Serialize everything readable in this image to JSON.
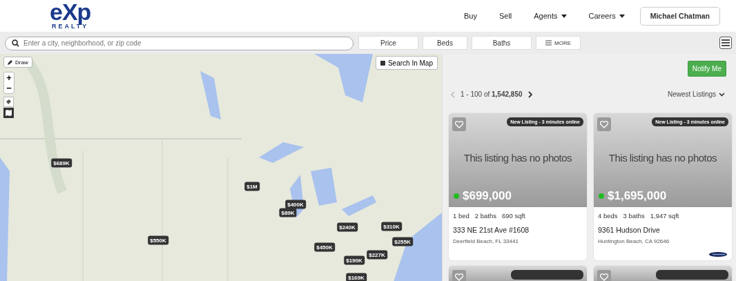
{
  "logo": {
    "mark": "eXp",
    "sub": "REALTY"
  },
  "nav": [
    {
      "label": "Buy",
      "dropdown": false
    },
    {
      "label": "Sell",
      "dropdown": false
    },
    {
      "label": "Agents",
      "dropdown": true
    },
    {
      "label": "Careers",
      "dropdown": true
    }
  ],
  "user_button": "Michael Chatman",
  "search": {
    "placeholder": "Enter a city, neighborhood, or zip code"
  },
  "filters": [
    {
      "label": "Price",
      "kind": "plain"
    },
    {
      "label": "Beds",
      "kind": "plain"
    },
    {
      "label": "Baths",
      "kind": "plain"
    },
    {
      "label": "MORE",
      "kind": "more"
    }
  ],
  "map": {
    "draw_button": "Draw",
    "zoom_in": "+",
    "zoom_out": "−",
    "search_in_map": "Search In Map",
    "pins": [
      {
        "label": "$689K"
      },
      {
        "label": "$1M"
      },
      {
        "label": "$400K"
      },
      {
        "label": "$89K"
      },
      {
        "label": "$240K"
      },
      {
        "label": "$550K"
      },
      {
        "label": "$450K"
      },
      {
        "label": "$310K"
      },
      {
        "label": "$255K"
      },
      {
        "label": "$227K"
      },
      {
        "label": "$190K"
      },
      {
        "label": "$169K"
      }
    ]
  },
  "notify_button": "Notify Me",
  "pagination": {
    "range": "1 - 100 of",
    "total": "1,542,850",
    "prev_disabled": true
  },
  "sort": "Newest Listings",
  "listings": [
    {
      "kind": "full",
      "badge": "New Listing - 3 minutes online",
      "no_photo": "This listing has no photos",
      "price": "$699,000",
      "color": "#22bb22",
      "beds": "1 bed",
      "baths": "2 baths",
      "sqft": "690 sqft",
      "address": "333 NE 21st Ave #1608",
      "city": "Deerfield Beach, FL 33441",
      "mls_logo": false
    },
    {
      "kind": "full",
      "badge": "New Listing - 3 minutes online",
      "no_photo": "This listing has no photos",
      "price": "$1,695,000",
      "color": "#22bb22",
      "beds": "4 beds",
      "baths": "3 baths",
      "sqft": "1,947 sqft",
      "address": "9361 Hudson Drive",
      "city": "Huntington Beach, CA 92646",
      "mls_logo": true
    },
    {
      "kind": "partial"
    },
    {
      "kind": "partial"
    }
  ]
}
